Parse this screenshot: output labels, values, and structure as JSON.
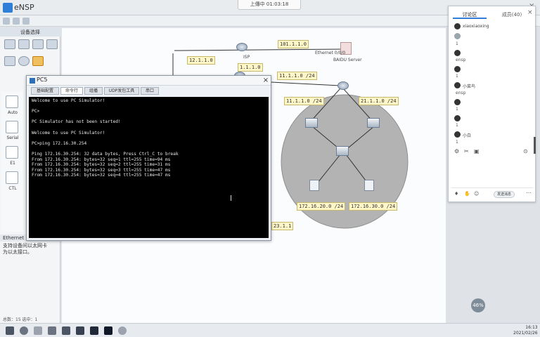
{
  "app": {
    "title": "eNSP"
  },
  "recording": {
    "label": "上傳中 01:03:18"
  },
  "device_panel": {
    "header": "设备选择",
    "cables": [
      {
        "label": "Auto"
      },
      {
        "label": "Serial"
      },
      {
        "label": "E1"
      },
      {
        "label": "CTL"
      }
    ],
    "ethernet_title": "Ethernet",
    "ethernet_desc": "支持设备间以太网卡\n为以太接口。"
  },
  "topology": {
    "ip_labels": [
      "12.1.1.0",
      "101.1.1.0",
      "11.1.1.0 /24",
      "11.1.1.0 /24",
      "21.1.1.0 /24",
      "172.16.20.0 /24",
      "172.16.30.0 /24",
      "1.1.1.0",
      "23.1.1"
    ],
    "server_label": "BAIDU Server",
    "isp_label": "ISP",
    "ethernet_label": "Ethernet 0/0/0"
  },
  "pc_window": {
    "title": "PC5",
    "tabs": [
      "基础配置",
      "命令行",
      "组播",
      "UDP发包工具",
      "串口"
    ],
    "active_tab": 1,
    "terminal_lines": [
      "Welcome to use PC Simulator!",
      "",
      "PC>",
      "",
      "PC Simulator has not been started!",
      "",
      "Welcome to use PC Simulator!",
      "",
      "PC>ping 172.16.30.254",
      "",
      "Ping 172.16.30.254: 32 data bytes, Press Ctrl_C to break",
      "From 172.16.30.254: bytes=32 seq=1 ttl=255 time=94 ms",
      "From 172.16.30.254: bytes=32 seq=2 ttl=255 time=31 ms",
      "From 172.16.30.254: bytes=32 seq=3 ttl=255 time=47 ms",
      "From 172.16.30.254: bytes=32 seq=4 ttl=255 time=47 ms"
    ]
  },
  "chat": {
    "tabs": [
      "讨论区",
      "成员(40)"
    ],
    "messages": [
      {
        "name": "xiaoxiaoxing",
        "text": ""
      },
      {
        "name": "",
        "text": "1"
      },
      {
        "name": "",
        "text": "ensp"
      },
      {
        "name": "",
        "text": "1"
      },
      {
        "name": "小菜鸟",
        "text": "ensp"
      },
      {
        "name": "",
        "text": "1"
      },
      {
        "name": "",
        "text": "1"
      },
      {
        "name": "小白",
        "text": "1"
      }
    ],
    "send_label": "发送消息"
  },
  "taskbar": {
    "time": "16:13",
    "date": "2021/02/26"
  },
  "status": {
    "text": "总数：15 选中：1"
  },
  "float": {
    "label": "46%"
  }
}
